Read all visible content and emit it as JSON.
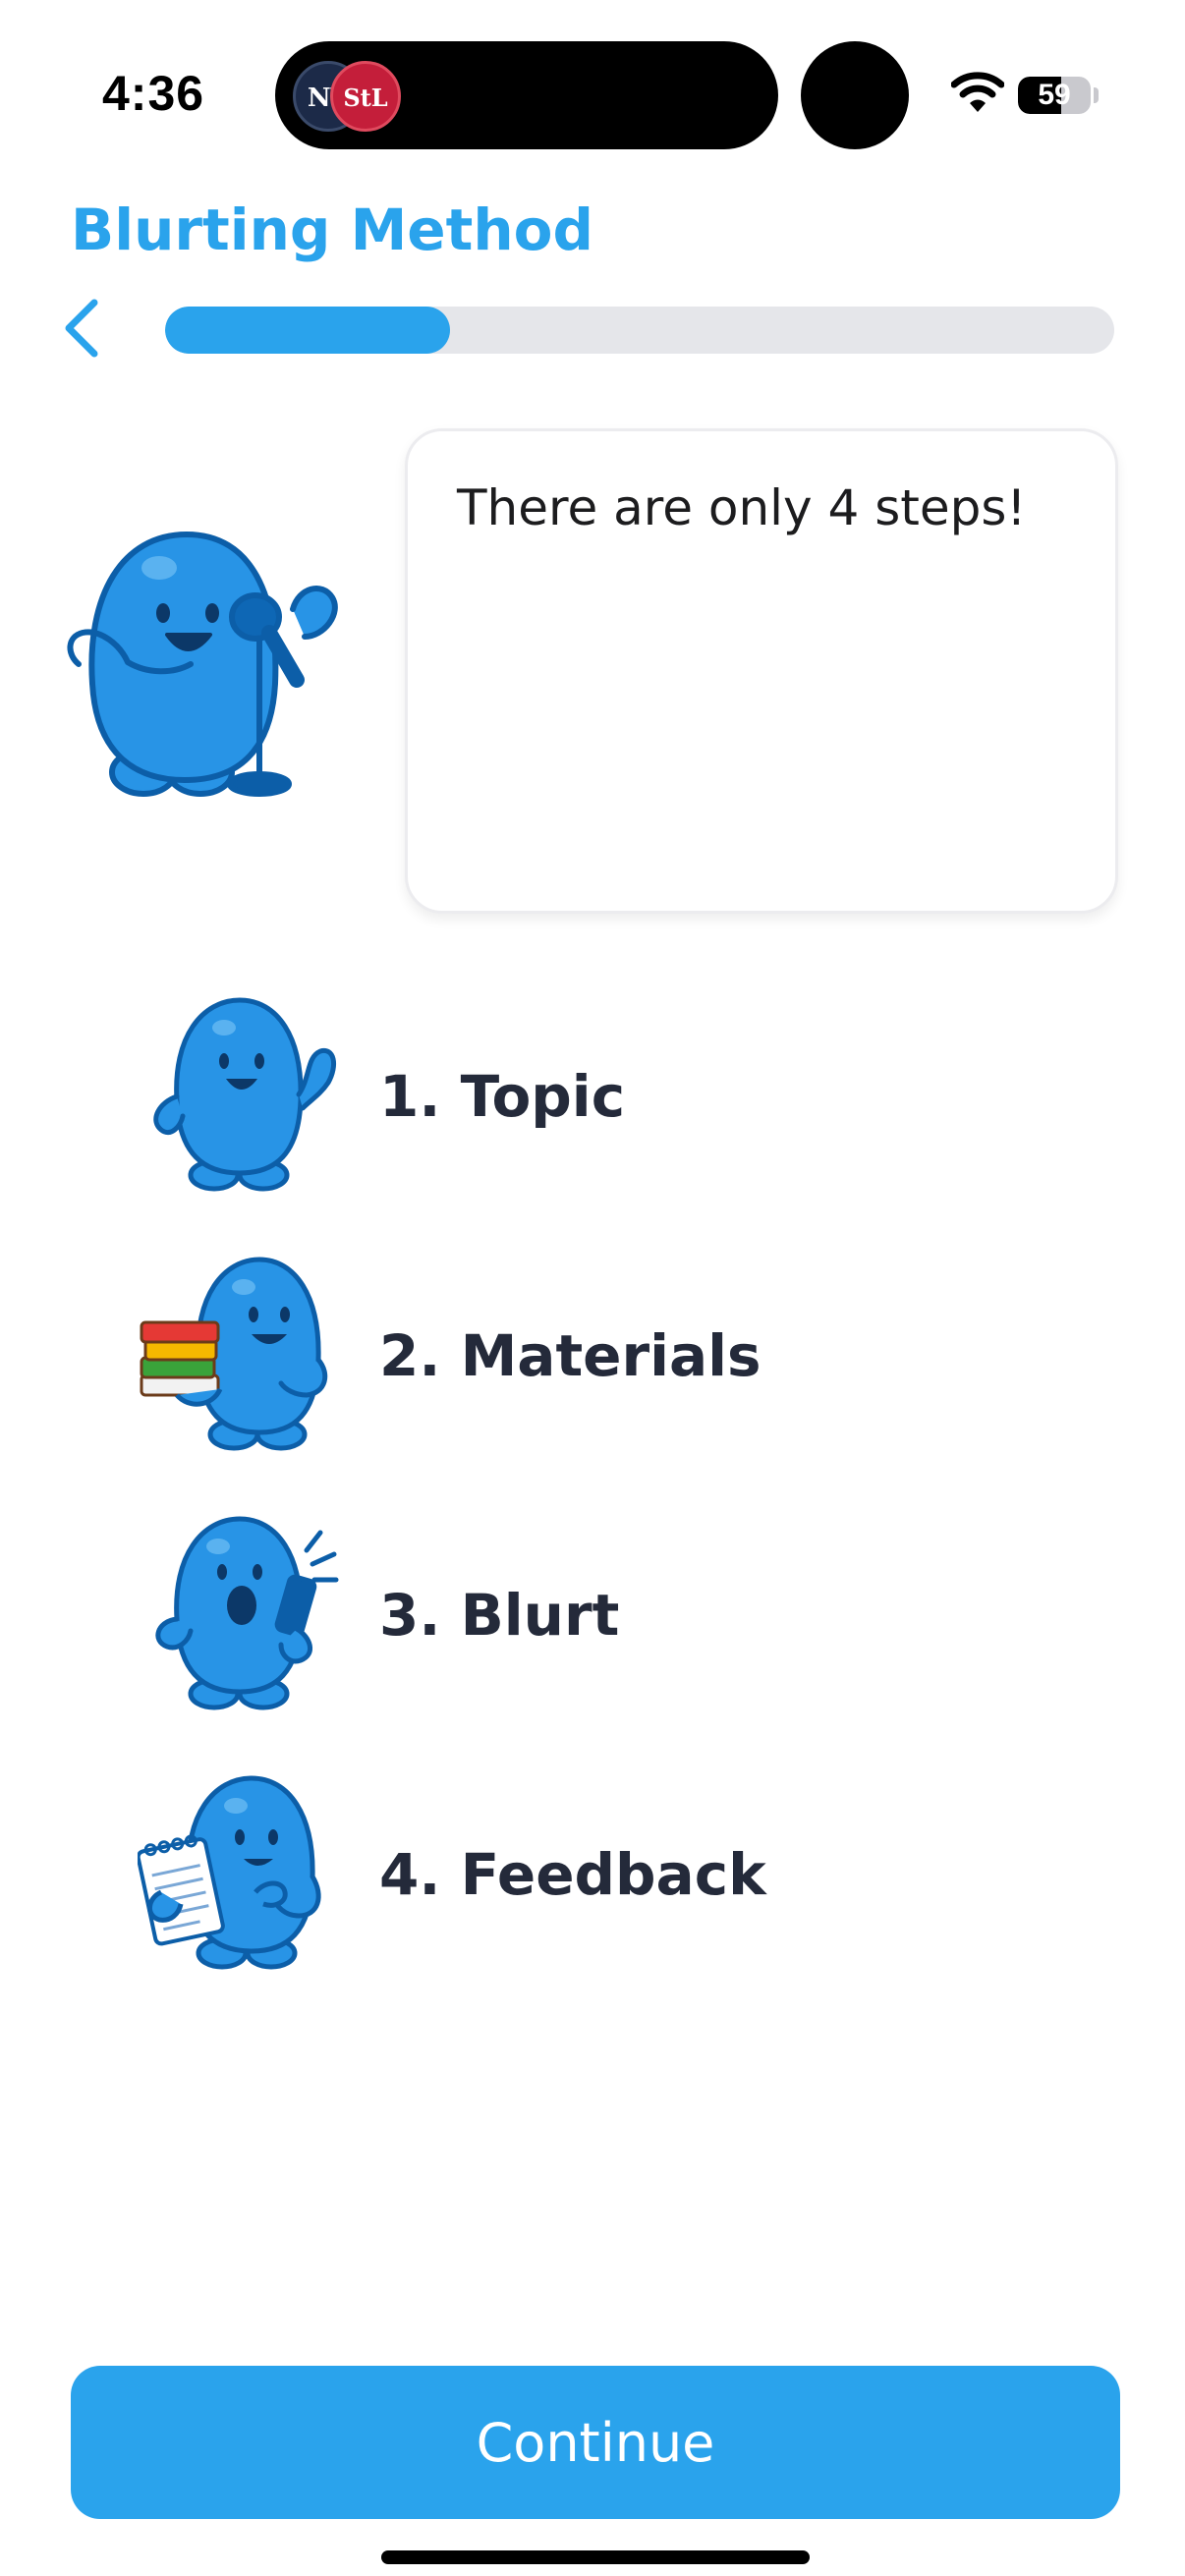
{
  "status_bar": {
    "time": "4:36",
    "battery_level": "59",
    "battery_fraction": 0.59,
    "badge_left_icon": "yankees-logo",
    "badge_right_icon": "cardinals-logo",
    "badge_left_text": "NY",
    "badge_right_text": "StL"
  },
  "header": {
    "title": "Blurting Method",
    "back_icon": "chevron-left-icon",
    "progress_fraction": 0.3
  },
  "speech": {
    "text": "There are only 4 steps!",
    "mascot_icon": "mascot-microphone-icon"
  },
  "steps": [
    {
      "label": "1. Topic",
      "icon": "mascot-waving-icon"
    },
    {
      "label": "2. Materials",
      "icon": "mascot-books-icon"
    },
    {
      "label": "3. Blurt",
      "icon": "mascot-shouting-icon"
    },
    {
      "label": "4. Feedback",
      "icon": "mascot-notepad-icon"
    }
  ],
  "footer": {
    "continue_label": "Continue"
  },
  "colors": {
    "accent": "#2aa3ec",
    "mascot_body": "#2894e6",
    "mascot_outline": "#0c5ea8",
    "track": "#e5e6ea",
    "text": "#242a3a"
  }
}
